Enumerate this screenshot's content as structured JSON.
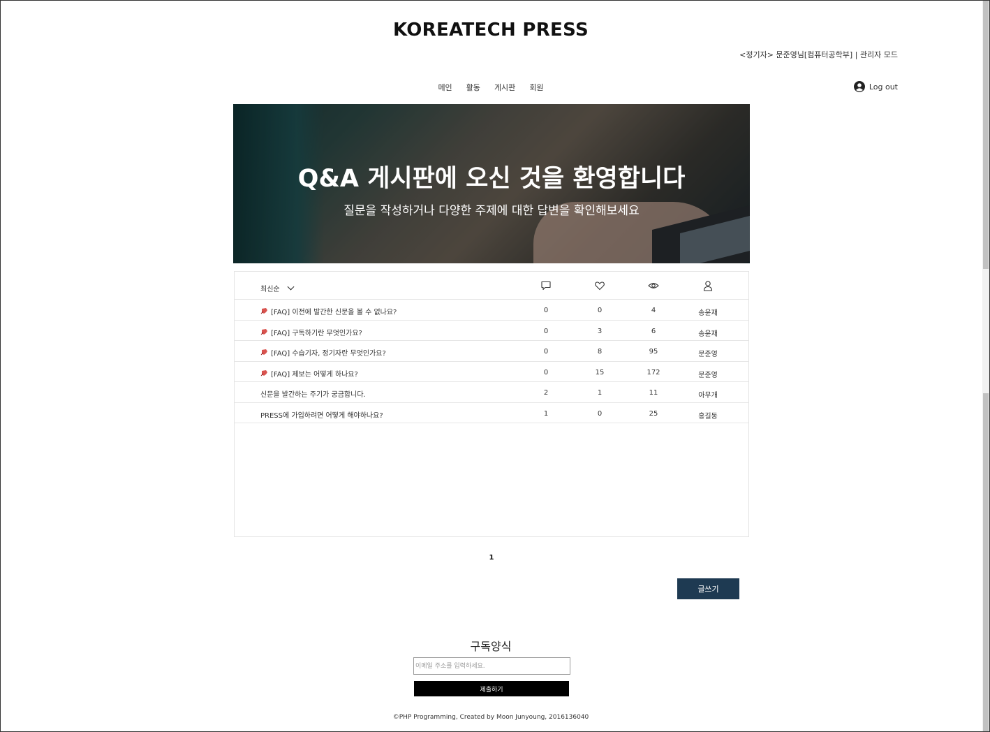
{
  "header": {
    "site_title": "KOREATECH PRESS",
    "user_info": "<정기자> 문준영님[컴퓨터공학부] | 관리자 모드",
    "logout_label": "Log out"
  },
  "nav": {
    "items": [
      {
        "label": "메인"
      },
      {
        "label": "활동"
      },
      {
        "label": "게시판"
      },
      {
        "label": "회원"
      }
    ]
  },
  "hero": {
    "title": "Q&A 게시판에 오신 것을 환영합니다",
    "subtitle": "질문을 작성하거나 다양한 주제에 대한 답변을 확인해보세요"
  },
  "board": {
    "sort_label": "최신순",
    "column_icons": [
      "comment-icon",
      "heart-icon",
      "eye-icon",
      "user-icon"
    ],
    "rows": [
      {
        "pinned": true,
        "title": "[FAQ] 이전에 발간한 신문을 볼 수 없나요?",
        "comments": "0",
        "likes": "0",
        "views": "4",
        "author": "송윤재"
      },
      {
        "pinned": true,
        "title": "[FAQ] 구독하기란 무엇인가요?",
        "comments": "0",
        "likes": "3",
        "views": "6",
        "author": "송윤재"
      },
      {
        "pinned": true,
        "title": "[FAQ] 수습기자, 정기자란 무엇인가요?",
        "comments": "0",
        "likes": "8",
        "views": "95",
        "author": "문준영"
      },
      {
        "pinned": true,
        "title": "[FAQ] 제보는 어떻게 하나요?",
        "comments": "0",
        "likes": "15",
        "views": "172",
        "author": "문준영"
      },
      {
        "pinned": false,
        "title": "신문을 발간하는 주기가 궁금합니다.",
        "comments": "2",
        "likes": "1",
        "views": "11",
        "author": "아무개"
      },
      {
        "pinned": false,
        "title": "PRESS에 가입하려면 어떻게 해야하나요?",
        "comments": "1",
        "likes": "0",
        "views": "25",
        "author": "홍길동"
      }
    ]
  },
  "pagination": {
    "current": "1"
  },
  "write_button": "글쓰기",
  "subscribe": {
    "title": "구독양식",
    "placeholder": "이메일 주소를 입력하세요.",
    "submit_label": "제출하기"
  },
  "footer": "©PHP Programming, Created by Moon Junyoung, 2016136040",
  "colors": {
    "write_button_bg": "#1e3a52",
    "submit_bg": "#000000",
    "pin_icon": "#d9534f"
  }
}
